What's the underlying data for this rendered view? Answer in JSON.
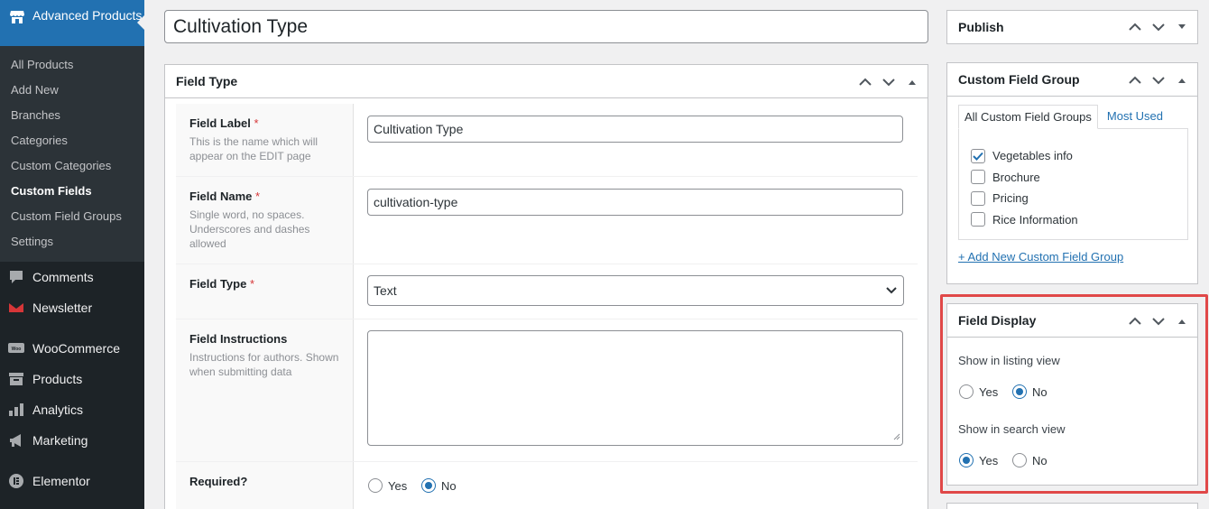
{
  "sidebar": {
    "current_menu": "Advanced Products",
    "submenu": [
      {
        "label": "All Products",
        "current": false
      },
      {
        "label": "Add New",
        "current": false
      },
      {
        "label": "Branches",
        "current": false
      },
      {
        "label": "Categories",
        "current": false
      },
      {
        "label": "Custom Categories",
        "current": false
      },
      {
        "label": "Custom Fields",
        "current": true
      },
      {
        "label": "Custom Field Groups",
        "current": false
      },
      {
        "label": "Settings",
        "current": false
      }
    ],
    "menu": [
      {
        "label": "Comments",
        "icon": "comment-icon"
      },
      {
        "label": "Newsletter",
        "icon": "envelope-icon"
      },
      {
        "label": "WooCommerce",
        "icon": "woocommerce-icon"
      },
      {
        "label": "Products",
        "icon": "archive-icon"
      },
      {
        "label": "Analytics",
        "icon": "bar-chart-icon"
      },
      {
        "label": "Marketing",
        "icon": "megaphone-icon"
      },
      {
        "label": "Elementor",
        "icon": "elementor-icon"
      }
    ]
  },
  "title": {
    "value": "Cultivation Type"
  },
  "field_type_box": {
    "heading": "Field Type",
    "fields": {
      "label": {
        "title": "Field Label",
        "required": "*",
        "desc": "This is the name which will appear on the EDIT page",
        "value": "Cultivation Type"
      },
      "name": {
        "title": "Field Name",
        "required": "*",
        "desc": "Single word, no spaces. Underscores and dashes allowed",
        "value": "cultivation-type"
      },
      "type": {
        "title": "Field Type",
        "required": "*",
        "value": "Text"
      },
      "instructions": {
        "title": "Field Instructions",
        "desc": "Instructions for authors. Shown when submitting data",
        "value": ""
      },
      "required": {
        "title": "Required?",
        "yes": "Yes",
        "no": "No",
        "selected": "No"
      }
    }
  },
  "publish_box": {
    "heading": "Publish"
  },
  "custom_field_group_box": {
    "heading": "Custom Field Group",
    "tabs": [
      {
        "label": "All Custom Field Groups",
        "active": true
      },
      {
        "label": "Most Used",
        "active": false
      }
    ],
    "items": [
      {
        "label": "Vegetables info",
        "checked": true
      },
      {
        "label": "Brochure",
        "checked": false
      },
      {
        "label": "Pricing",
        "checked": false
      },
      {
        "label": "Rice Information",
        "checked": false
      }
    ],
    "add_link": "+ Add New Custom Field Group"
  },
  "field_display_box": {
    "heading": "Field Display",
    "listing": {
      "question": "Show in listing view",
      "yes": "Yes",
      "no": "No",
      "selected": "No"
    },
    "search": {
      "question": "Show in search view",
      "yes": "Yes",
      "no": "No",
      "selected": "Yes"
    }
  },
  "colors": {
    "accent": "#2271b1",
    "sidebar": "#1d2327",
    "highlight": "#e04848",
    "required": "#d63638"
  }
}
